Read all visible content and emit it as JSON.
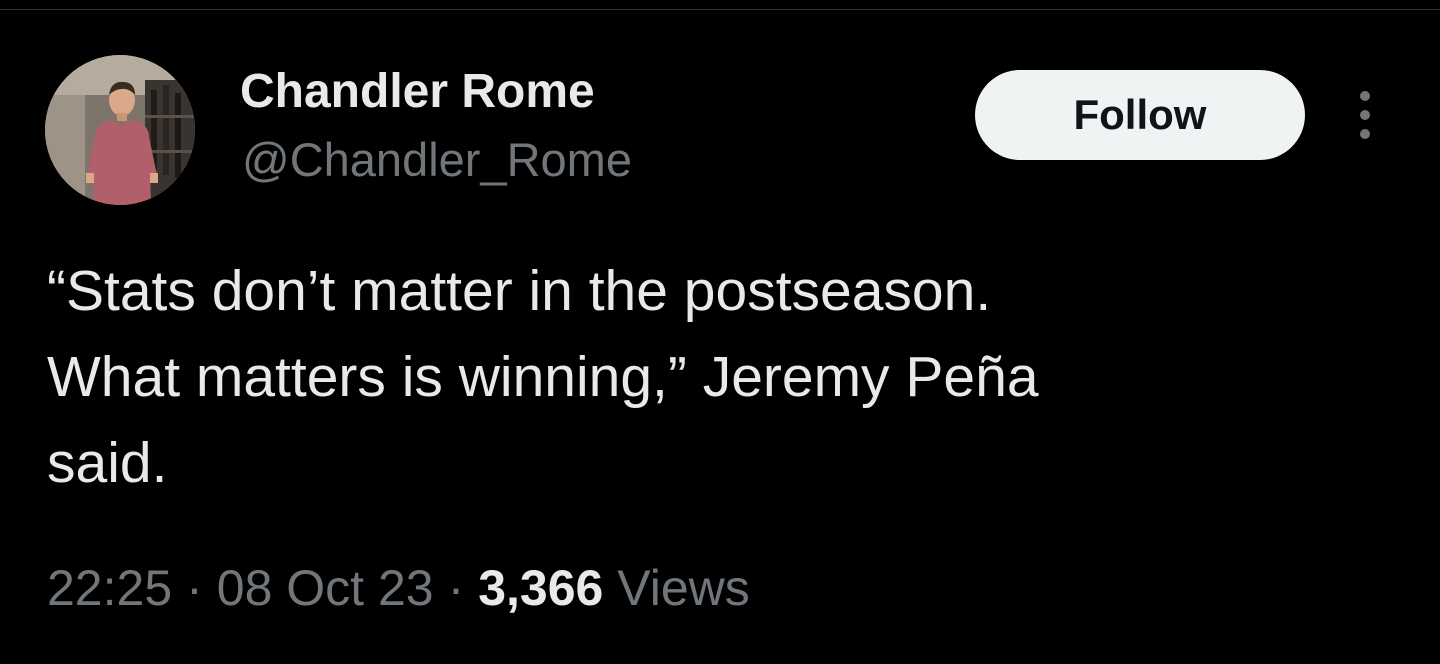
{
  "tweet": {
    "author": {
      "name": "Chandler Rome",
      "handle": "@Chandler_Rome"
    },
    "follow_label": "Follow",
    "text": "“Stats don’t matter in the postseason.\nWhat matters is winning,” Jeremy Peña\nsaid.",
    "time": "22:25",
    "separator": "·",
    "date": "08 Oct 23",
    "views_count": "3,366",
    "views_label": "Views"
  },
  "icons": {
    "more": "more-vertical-icon",
    "avatar": "profile-photo"
  },
  "colors": {
    "background": "#000000",
    "primary_text": "#e7e9ea",
    "secondary_text": "#71767b",
    "follow_button_bg": "#eff3f4",
    "follow_button_text": "#0f1419"
  }
}
